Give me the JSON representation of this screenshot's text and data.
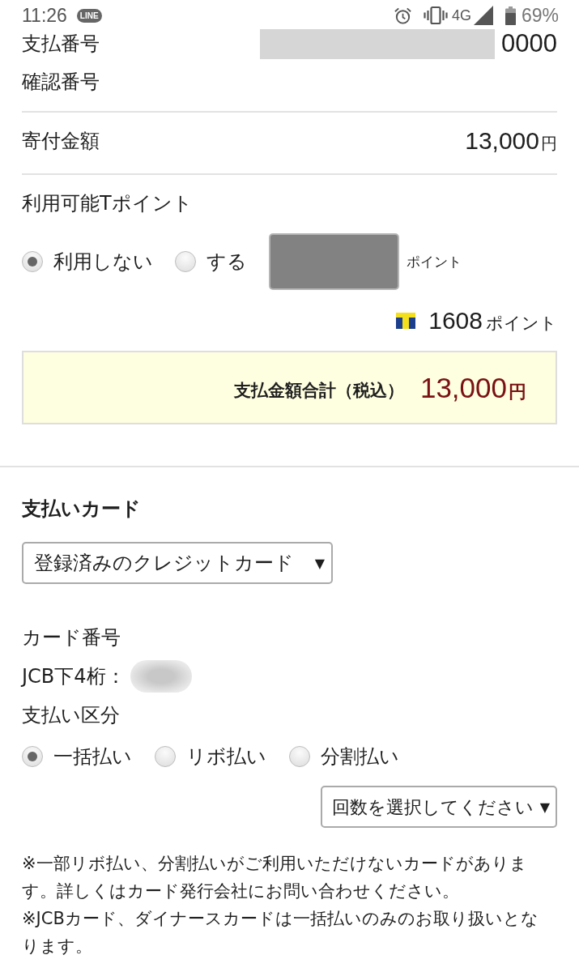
{
  "status_bar": {
    "time": "11:26",
    "notification": "LINE",
    "network": "4G",
    "battery": "69%"
  },
  "payment_info": [
    {
      "label": "支払番号",
      "value": "0000",
      "redacted": true
    },
    {
      "label": "確認番号"
    }
  ],
  "donation": {
    "label": "寄付金額",
    "amount": "13,000",
    "unit": "円"
  },
  "tpoint": {
    "label": "利用可能Tポイント",
    "options": [
      {
        "label": "利用しない",
        "selected": true
      },
      {
        "label": "する",
        "selected": false
      }
    ],
    "points_field": {
      "disabled": true
    },
    "field_unit": "ポイント",
    "balance": "1608",
    "balance_unit": "ポイント"
  },
  "total": {
    "label": "支払金額合計（税込）",
    "amount": "13,000",
    "unit": "円"
  },
  "card": {
    "heading": "支払いカード",
    "card_select": {
      "value": "登録済みのクレジットカード",
      "arrow": "▼"
    },
    "number_label": "カード番号",
    "last4_label": "JCB下4桁：",
    "last4_redacted": true,
    "method_label": "支払い区分",
    "methods": [
      {
        "label": "一括払い",
        "selected": true
      },
      {
        "label": "リボ払い",
        "selected": false
      },
      {
        "label": "分割払い",
        "selected": false
      }
    ],
    "installments_select": {
      "value": "回数を選択してください",
      "arrow": "▼"
    }
  },
  "notes": [
    "※一部リボ払い、分割払いがご利用いただけないカードがあります。詳しくはカード発行会社にお問い合わせください。",
    "※JCBカード、ダイナースカードは一括払いのみのお取り扱いとなります。"
  ]
}
